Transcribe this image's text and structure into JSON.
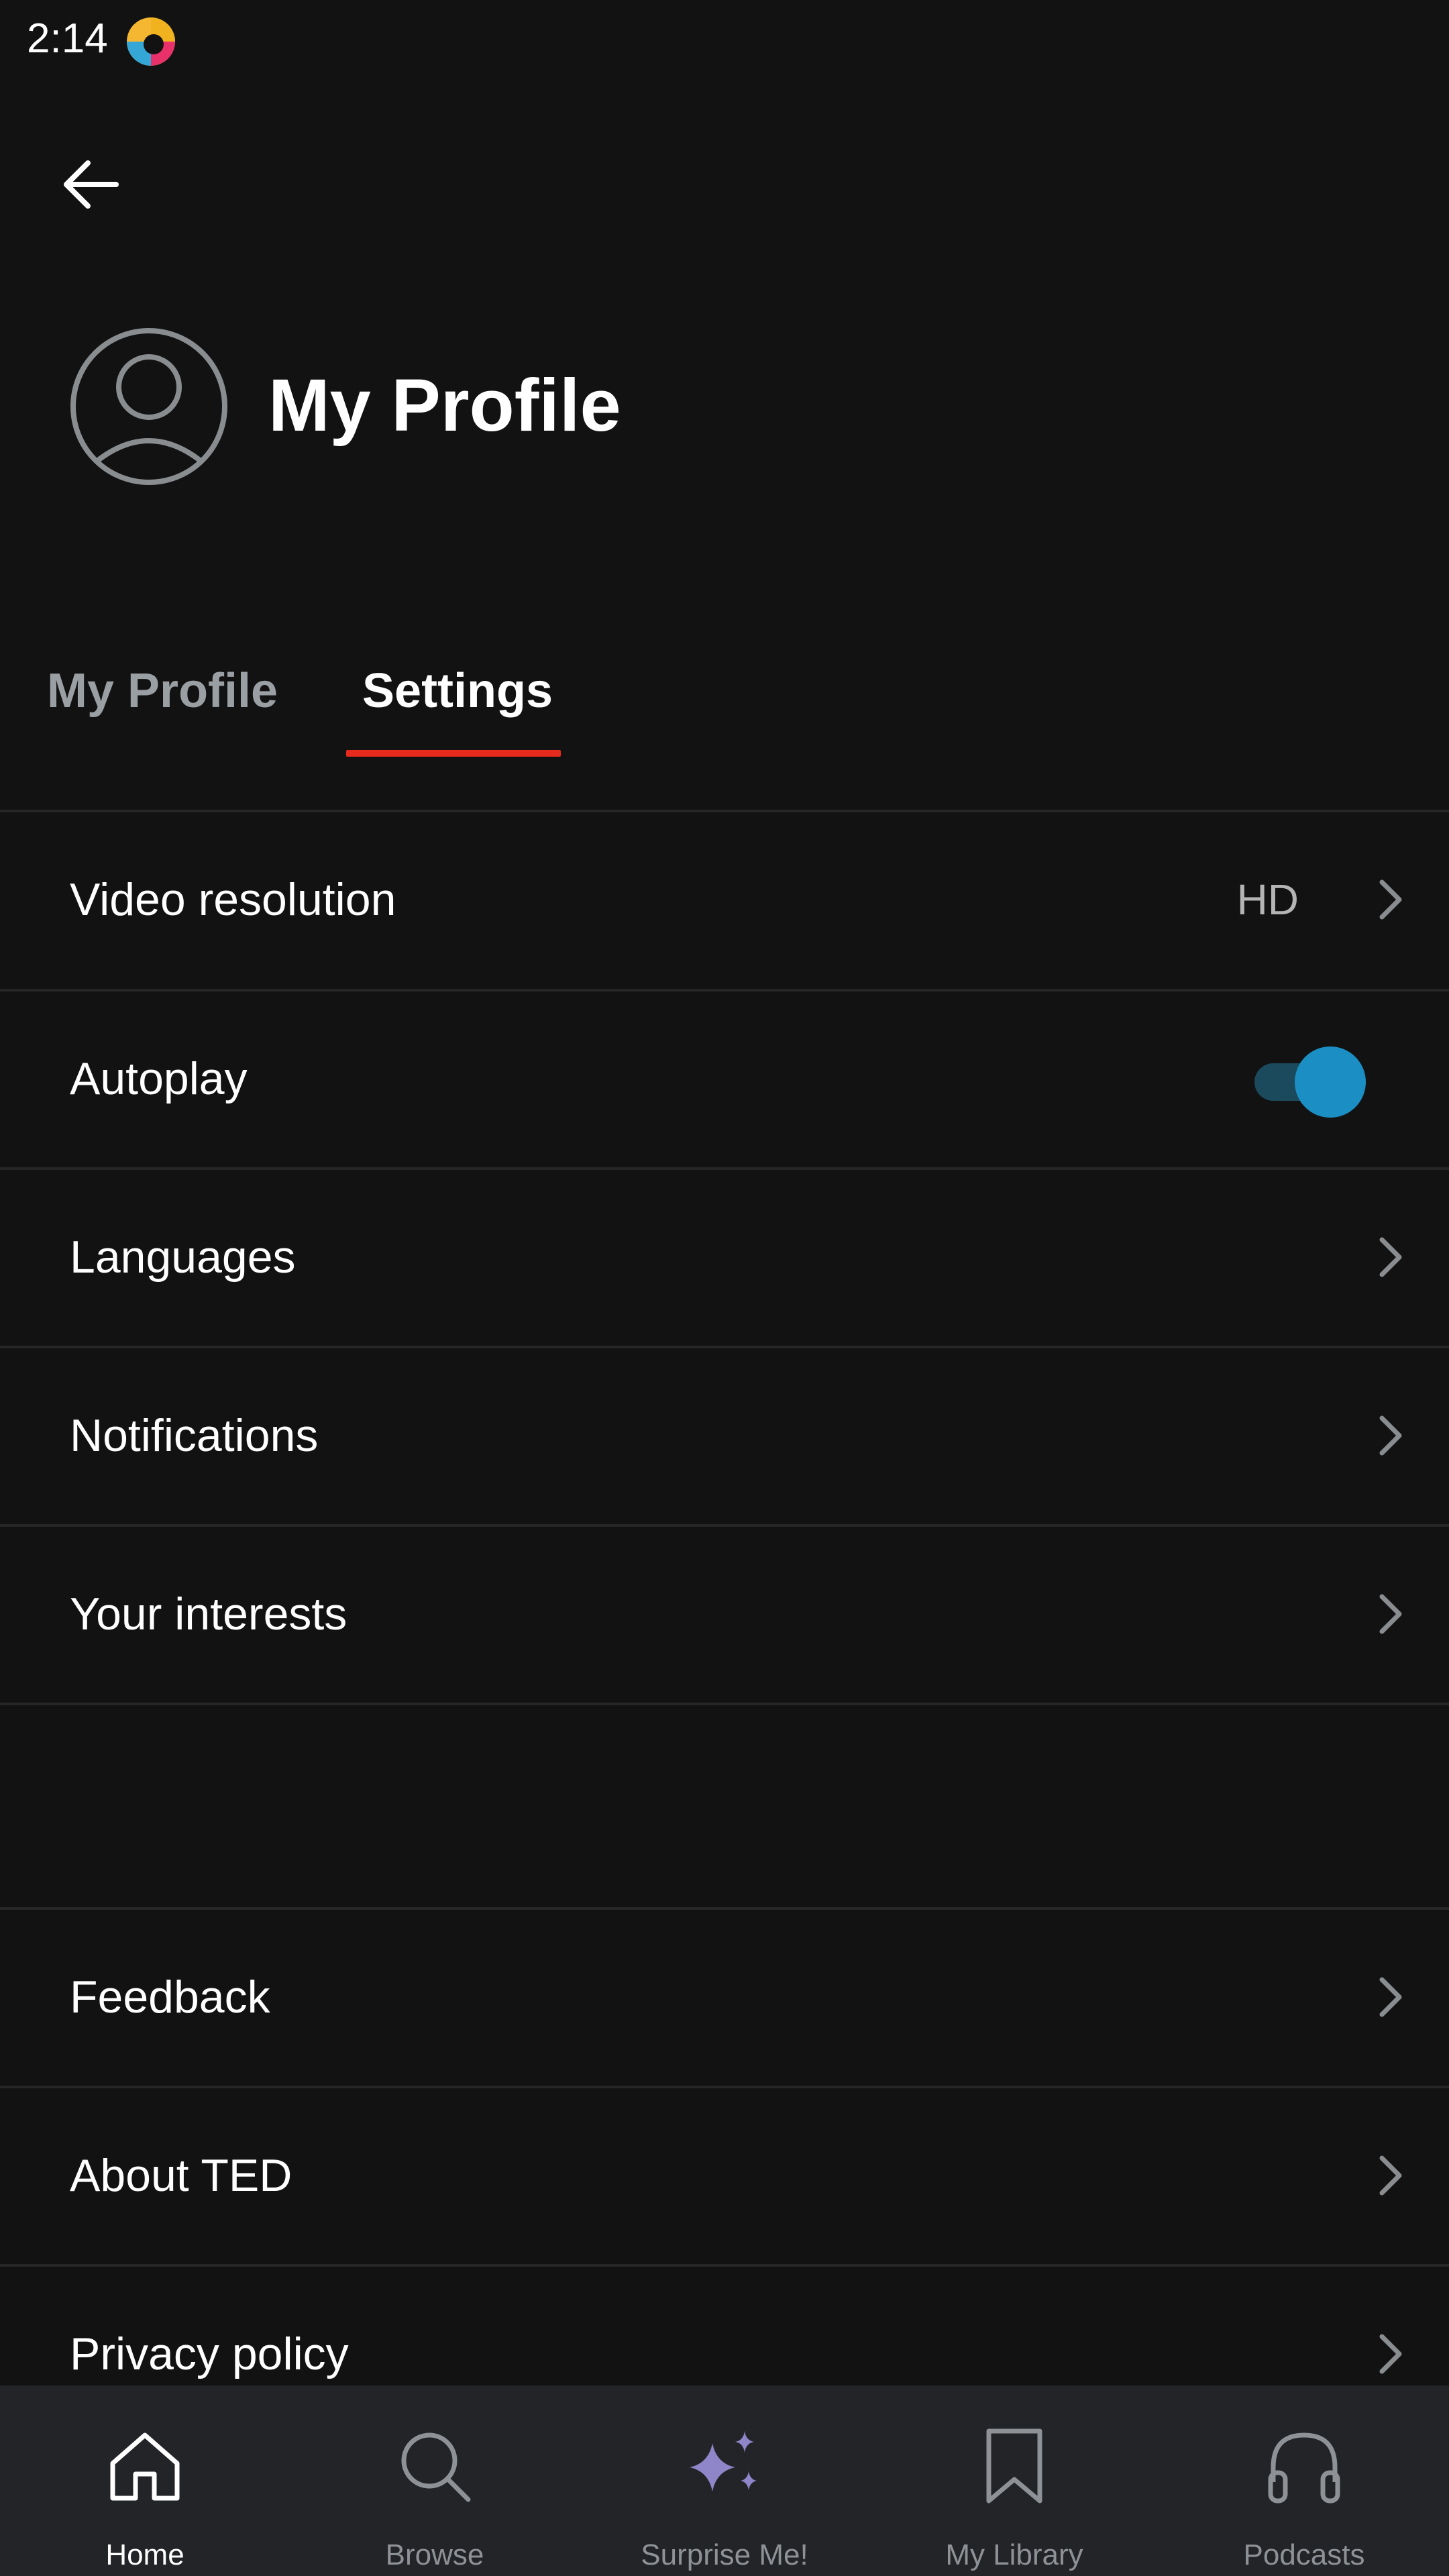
{
  "status_bar": {
    "time": "2:14"
  },
  "header": {
    "title": "My Profile"
  },
  "tabs": [
    {
      "label": "My Profile",
      "selected": false
    },
    {
      "label": "Settings",
      "selected": true
    }
  ],
  "settings": {
    "video_resolution": {
      "label": "Video resolution",
      "value": "HD"
    },
    "autoplay": {
      "label": "Autoplay",
      "enabled": true
    },
    "languages": {
      "label": "Languages"
    },
    "notifications": {
      "label": "Notifications"
    },
    "interests": {
      "label": "Your interests"
    },
    "feedback": {
      "label": "Feedback"
    },
    "about": {
      "label": "About TED"
    },
    "privacy": {
      "label": "Privacy policy"
    }
  },
  "bottom_nav": [
    {
      "label": "Home",
      "icon": "home-icon",
      "active": true
    },
    {
      "label": "Browse",
      "icon": "search-icon",
      "active": false
    },
    {
      "label": "Surprise Me!",
      "icon": "sparkle-icon",
      "active": false
    },
    {
      "label": "My Library",
      "icon": "bookmark-icon",
      "active": false
    },
    {
      "label": "Podcasts",
      "icon": "headphones-icon",
      "active": false
    }
  ],
  "colors": {
    "background": "#121212",
    "accent_red": "#e62b1e",
    "toggle_blue": "#1b8fc4",
    "nav_background": "#222428",
    "sparkle_purple": "#8e86c8"
  }
}
